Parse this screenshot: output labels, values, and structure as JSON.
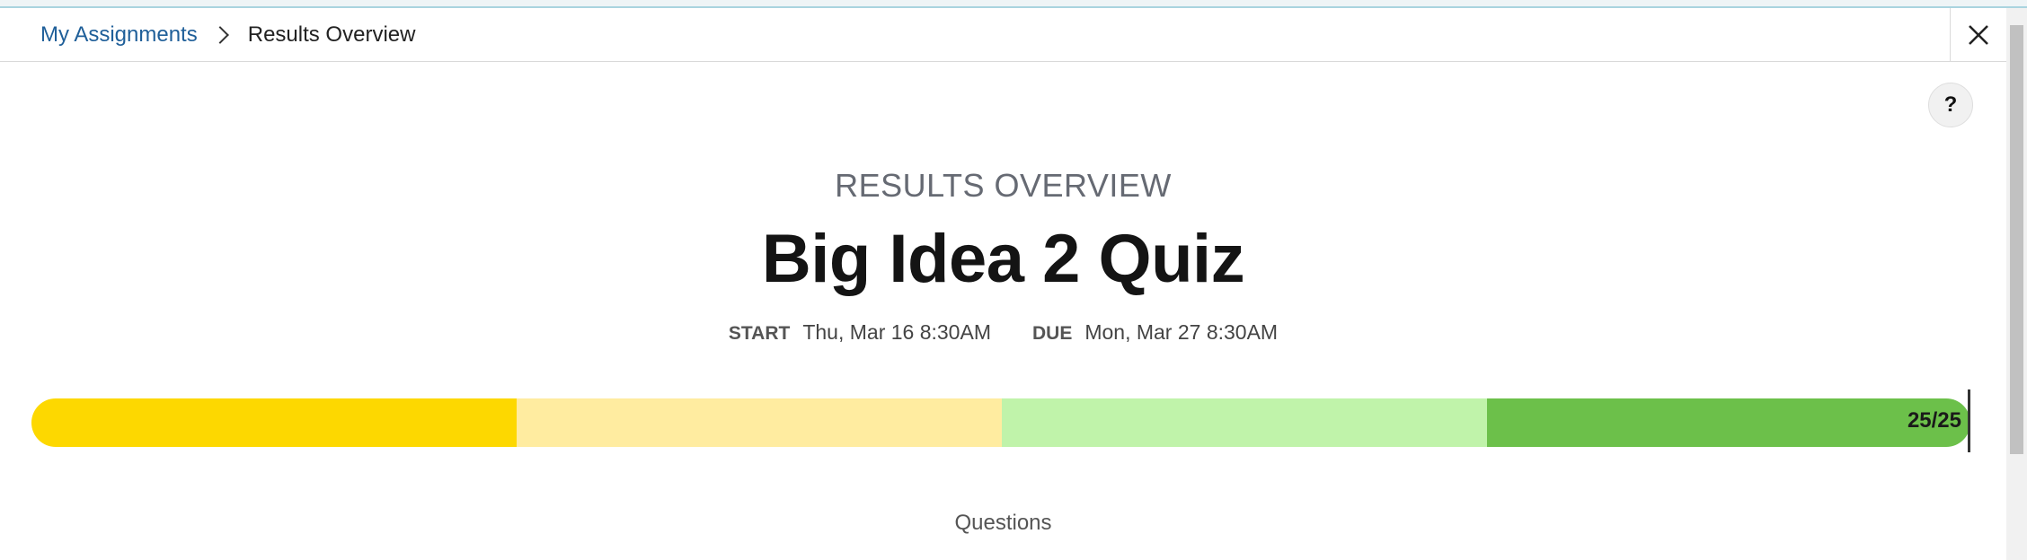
{
  "breadcrumb": {
    "parent_label": "My Assignments",
    "current_label": "Results Overview"
  },
  "header": {
    "close_icon": "close-icon"
  },
  "help": {
    "label": "?"
  },
  "main": {
    "section_label": "RESULTS OVERVIEW",
    "title": "Big Idea 2 Quiz",
    "start_label": "START",
    "start_value": "Thu, Mar 16 8:30AM",
    "due_label": "DUE",
    "due_value": "Mon, Mar 27 8:30AM"
  },
  "score": {
    "label": "25/25",
    "earned": 25,
    "total": 25,
    "segment_colors": [
      "#fdd800",
      "#ffeca0",
      "#c0f3aa",
      "#6cc04a"
    ]
  },
  "questions": {
    "label": "Questions"
  }
}
